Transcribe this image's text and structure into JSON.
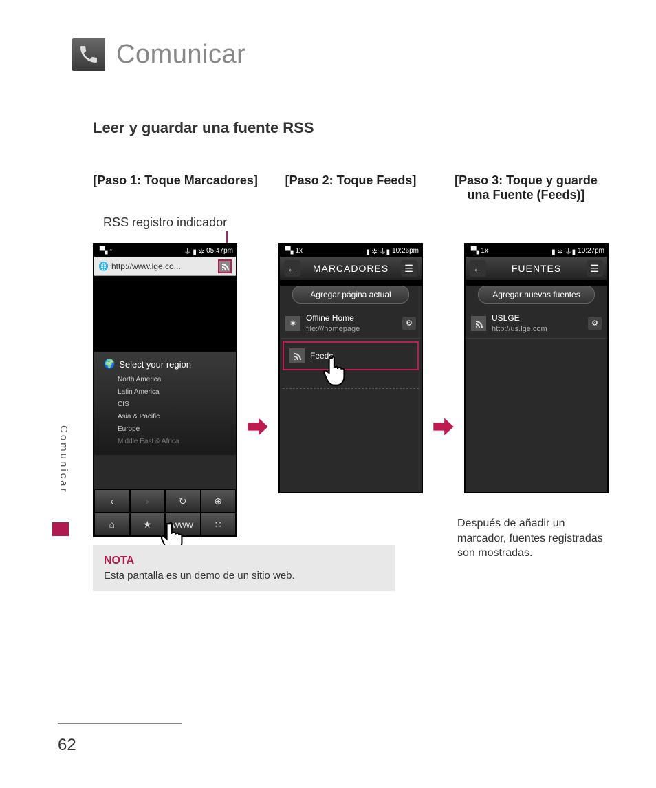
{
  "page": {
    "title": "Comunicar",
    "section_title": "Leer y guardar una fuente RSS",
    "side_tab": "Comunicar",
    "page_number": "62"
  },
  "steps": {
    "step1": "[Paso 1: Toque Marcadores]",
    "step2": "[Paso 2: Toque Feeds]",
    "step3": "[Paso 3: Toque y guarde una Fuente (Feeds)]",
    "rss_indicator_label": "RSS registro indicador"
  },
  "phone1": {
    "time": "05:47pm",
    "url": "http://www.lge.co...",
    "region_title": "Select your region",
    "regions": [
      "North America",
      "Latin America",
      "CIS",
      "Asia & Pacific",
      "Europe",
      "Middle East & Africa"
    ],
    "nav": {
      "www": "www"
    }
  },
  "phone2": {
    "time": "10:26pm",
    "title": "MARCADORES",
    "add_button": "Agregar página actual",
    "item1_title": "Offline Home",
    "item1_sub": "file:///homepage",
    "feeds_label": "Feeds"
  },
  "phone3": {
    "time": "10:27pm",
    "title": "FUENTES",
    "add_button": "Agregar nuevas fuentes",
    "item1_title": "USLGE",
    "item1_sub": "http://us.lge.com"
  },
  "note": {
    "heading": "NOTA",
    "text": "Esta pantalla es un demo de un sitio web."
  },
  "after_text": "Después de añadir un marcador, fuentes registradas son mostradas."
}
